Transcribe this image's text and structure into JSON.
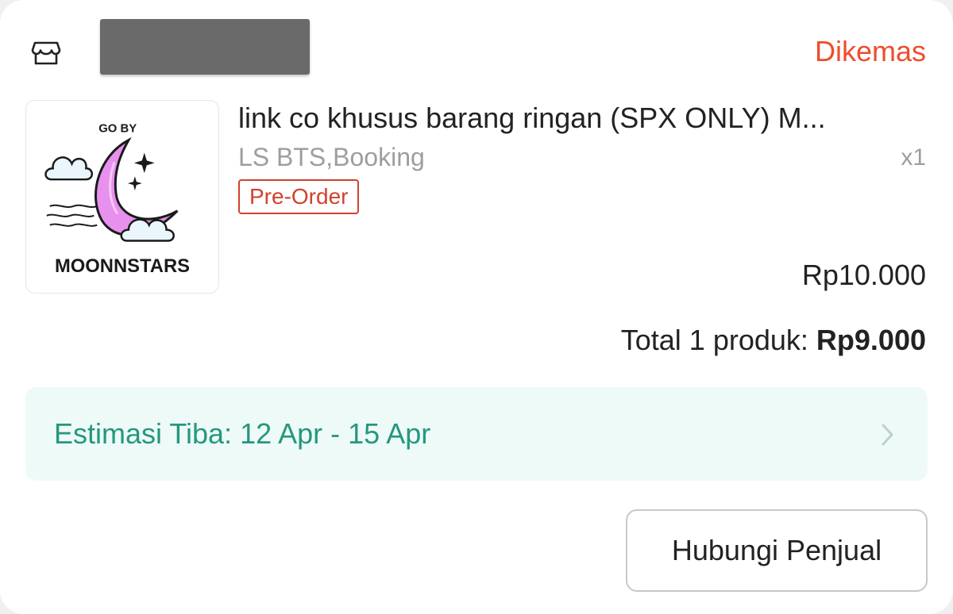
{
  "shop": {
    "icon": "shop-icon",
    "status": "Dikemas"
  },
  "product": {
    "thumbnail": {
      "top_text": "GO BY",
      "brand_text": "MOONNSTARS",
      "colors": {
        "moon": "#e890ee",
        "outline": "#1a1a1a",
        "cloud": "#eaf6fb"
      }
    },
    "title": "link co khusus barang ringan (SPX ONLY) M...",
    "variant": "LS BTS,Booking",
    "quantity": "x1",
    "tag": "Pre-Order",
    "price": "Rp10.000"
  },
  "total": {
    "label": "Total 1 produk:",
    "amount": "Rp9.000"
  },
  "estimate": {
    "text": "Estimasi Tiba: 12 Apr - 15 Apr",
    "icon": "chevron-right-icon"
  },
  "actions": {
    "contact_seller": "Hubungi Penjual"
  },
  "colors": {
    "accent": "#ee4d2d",
    "tag": "#d0422d",
    "estimate_text": "#25977e",
    "estimate_bg": "#eefaf7"
  }
}
